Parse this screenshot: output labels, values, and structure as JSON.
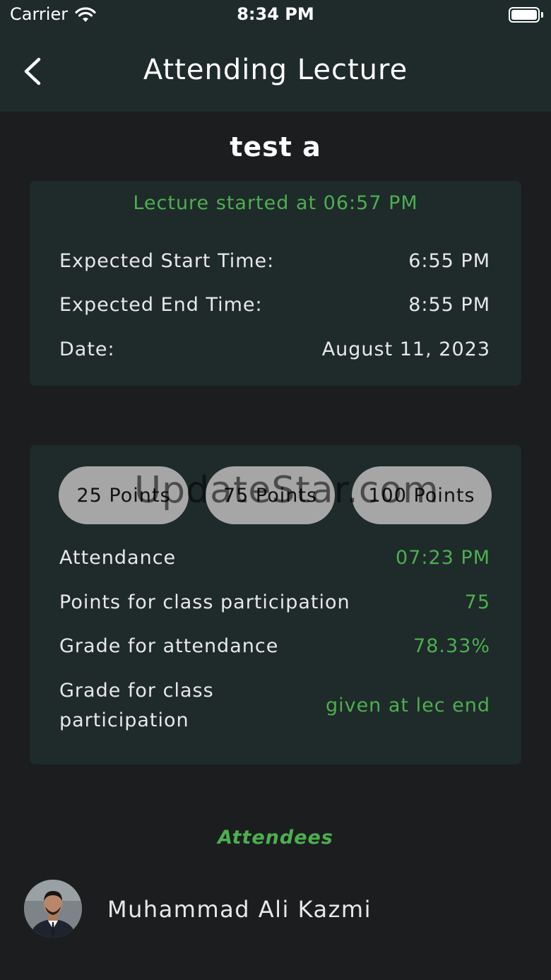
{
  "status_bar": {
    "carrier": "Carrier",
    "time": "8:34 PM"
  },
  "nav": {
    "title": "Attending Lecture"
  },
  "lecture": {
    "name": "test a"
  },
  "schedule_card": {
    "started_text": "Lecture started at 06:57 PM",
    "rows": [
      {
        "label": "Expected Start Time:",
        "value": "6:55 PM"
      },
      {
        "label": "Expected End Time:",
        "value": "8:55 PM"
      },
      {
        "label": "Date:",
        "value": "August 11, 2023"
      }
    ]
  },
  "points_card": {
    "buttons": [
      "25 Points",
      "75 Points",
      "100 Points"
    ],
    "rows": [
      {
        "label": "Attendance",
        "value": "07:23 PM"
      },
      {
        "label": "Points for class participation",
        "value": "75"
      },
      {
        "label": "Grade for attendance",
        "value": "78.33%"
      },
      {
        "label_line1": "Grade for class",
        "label_line2": "participation",
        "value": "given at lec end"
      }
    ]
  },
  "watermark": "UpdateStar.com",
  "attendees": {
    "title": "Attendees",
    "items": [
      {
        "name": "Muhammad Ali Kazmi"
      }
    ]
  },
  "colors": {
    "accent": "#4caf50",
    "card_bg": "#1f2a2a",
    "page_bg": "#1b1d1e",
    "pill_bg": "#a6a6a6"
  },
  "icons": {
    "back": "chevron-left-icon",
    "wifi": "wifi-icon",
    "battery": "battery-icon"
  }
}
